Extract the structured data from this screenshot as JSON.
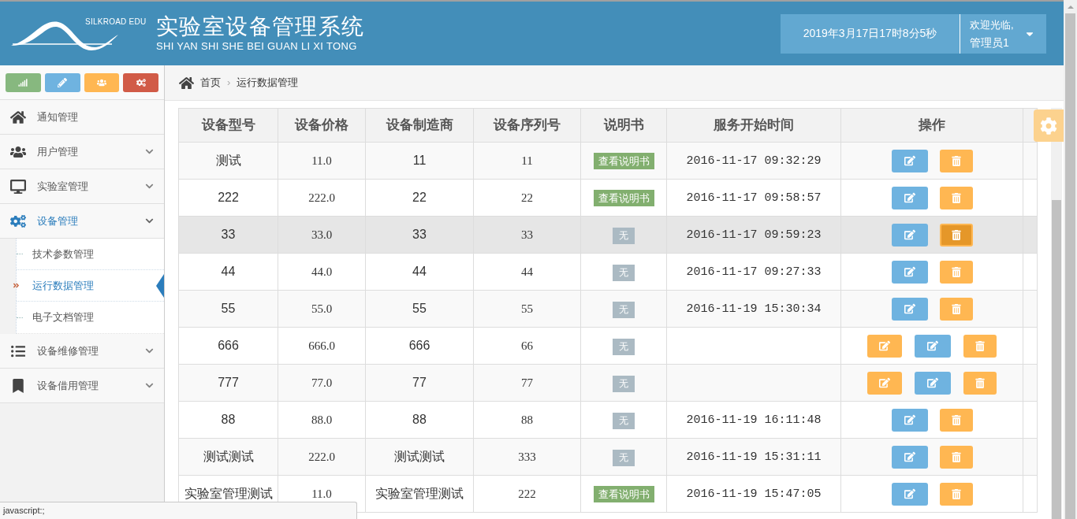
{
  "header": {
    "logo_text": "SILKROAD EDU",
    "title": "实验室设备管理系统",
    "subtitle": "SHI YAN SHI SHE BEI GUAN LI XI TONG",
    "datetime": "2019年3月17日17时8分5秒",
    "welcome": "欢迎光临,",
    "user": "管理员1"
  },
  "shortcuts": [
    {
      "color": "#87b87f"
    },
    {
      "color": "#6fb3e0"
    },
    {
      "color": "#ffb752"
    },
    {
      "color": "#d15b47"
    }
  ],
  "sidebar": {
    "items": [
      {
        "kind": "link",
        "label": "通知管理",
        "selected": false
      },
      {
        "kind": "group",
        "label": "用户管理",
        "expanded": false,
        "selected": false
      },
      {
        "kind": "group",
        "label": "实验室管理",
        "expanded": false,
        "selected": false
      },
      {
        "kind": "group",
        "label": "设备管理",
        "expanded": true,
        "selected": true,
        "children": [
          {
            "label": "技术参数管理",
            "selected": false
          },
          {
            "label": "运行数据管理",
            "selected": true
          },
          {
            "label": "电子文档管理",
            "selected": false
          }
        ]
      },
      {
        "kind": "group",
        "label": "设备维修管理",
        "expanded": false,
        "selected": false
      },
      {
        "kind": "group",
        "label": "设备借用管理",
        "expanded": false,
        "selected": false
      }
    ]
  },
  "breadcrumb": [
    "首页",
    "›",
    "运行数据管理"
  ],
  "table": {
    "columns": [
      "设备型号",
      "设备价格",
      "设备制造商",
      "设备序列号",
      "说明书",
      "服务开始时间",
      "操作"
    ],
    "rows": [
      {
        "highlighted": false,
        "cells": [
          "测试",
          "11.0",
          "11",
          "11"
        ],
        "manual": {
          "kind": "link",
          "text": "查看说明书"
        },
        "time": "2016-11-17 09:32:29",
        "actions": [
          {
            "kind": "edit",
            "active": false
          },
          {
            "kind": "delete",
            "active": false
          }
        ]
      },
      {
        "highlighted": false,
        "cells": [
          "222",
          "222.0",
          "22",
          "22"
        ],
        "manual": {
          "kind": "link",
          "text": "查看说明书"
        },
        "time": "2016-11-17 09:58:57",
        "actions": [
          {
            "kind": "edit",
            "active": false
          },
          {
            "kind": "delete",
            "active": false
          }
        ]
      },
      {
        "highlighted": true,
        "cells": [
          "33",
          "33.0",
          "33",
          "33"
        ],
        "manual": {
          "kind": "none",
          "text": "无"
        },
        "time": "2016-11-17 09:59:23",
        "actions": [
          {
            "kind": "edit",
            "active": false
          },
          {
            "kind": "delete",
            "active": true
          }
        ]
      },
      {
        "highlighted": false,
        "cells": [
          "44",
          "44.0",
          "44",
          "44"
        ],
        "manual": {
          "kind": "none",
          "text": "无"
        },
        "time": "2016-11-17 09:27:33",
        "actions": [
          {
            "kind": "edit",
            "active": false
          },
          {
            "kind": "delete",
            "active": false
          }
        ]
      },
      {
        "highlighted": false,
        "cells": [
          "55",
          "55.0",
          "55",
          "55"
        ],
        "manual": {
          "kind": "none",
          "text": "无"
        },
        "time": "2016-11-19 15:30:34",
        "actions": [
          {
            "kind": "edit",
            "active": false
          },
          {
            "kind": "delete",
            "active": false
          }
        ]
      },
      {
        "highlighted": false,
        "cells": [
          "666",
          "666.0",
          "666",
          "66"
        ],
        "manual": {
          "kind": "none",
          "text": "无"
        },
        "actions": [
          {
            "kind": "edit_alt",
            "active": false
          },
          {
            "kind": "edit",
            "active": false
          },
          {
            "kind": "delete",
            "active": false
          }
        ]
      },
      {
        "highlighted": false,
        "cells": [
          "777",
          "77.0",
          "77",
          "77"
        ],
        "manual": {
          "kind": "none",
          "text": "无"
        },
        "actions": [
          {
            "kind": "edit_alt",
            "active": false
          },
          {
            "kind": "edit",
            "active": false
          },
          {
            "kind": "delete",
            "active": false
          }
        ]
      },
      {
        "highlighted": false,
        "cells": [
          "88",
          "88.0",
          "88",
          "88"
        ],
        "manual": {
          "kind": "none",
          "text": "无"
        },
        "time": "2016-11-19 16:11:48",
        "actions": [
          {
            "kind": "edit",
            "active": false
          },
          {
            "kind": "delete",
            "active": false
          }
        ]
      },
      {
        "highlighted": false,
        "cells": [
          "测试测试",
          "222.0",
          "测试测试",
          "333"
        ],
        "manual": {
          "kind": "none",
          "text": "无"
        },
        "time": "2016-11-19 15:31:11",
        "actions": [
          {
            "kind": "edit",
            "active": false
          },
          {
            "kind": "delete",
            "active": false
          }
        ]
      },
      {
        "highlighted": false,
        "cells": [
          "实验室管理测试",
          "11.0",
          "实验室管理测试",
          "222"
        ],
        "manual": {
          "kind": "link",
          "text": "查看说明书"
        },
        "time": "2016-11-19 15:47:05",
        "actions": [
          {
            "kind": "edit",
            "active": false
          },
          {
            "kind": "delete",
            "active": false
          }
        ]
      }
    ]
  },
  "status_bar": "javascript:;"
}
